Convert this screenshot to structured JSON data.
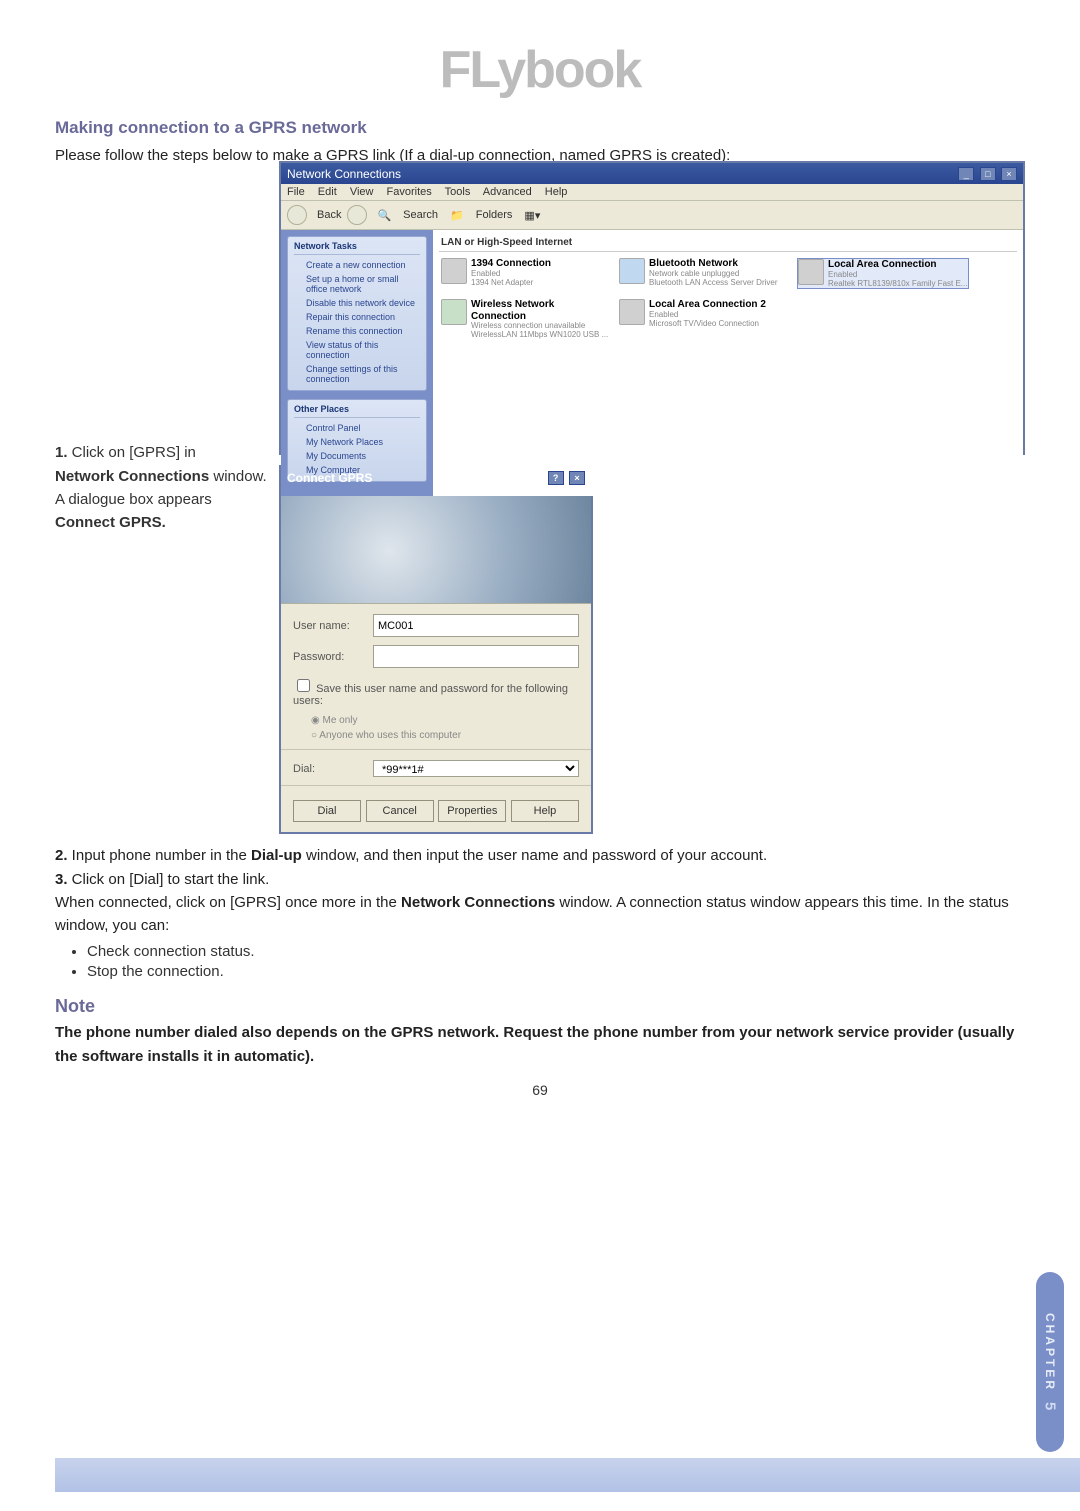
{
  "logo_text": "FLybook",
  "heading": "Making connection to a GPRS network",
  "intro": "Please follow the steps below to make a GPRS link (If a dial-up connection, named GPRS is created):",
  "step1_lead": "1.",
  "step1_text_a": " Click on [GPRS] in ",
  "step1_bold": "Network Connections",
  "step1_text_b": " window.",
  "step1_text_c": "A dialogue box appears ",
  "step1_bold2": "Connect GPRS.",
  "nc": {
    "title": "Network Connections",
    "menu": [
      "File",
      "Edit",
      "View",
      "Favorites",
      "Tools",
      "Advanced",
      "Help"
    ],
    "toolbar": {
      "back": "Back",
      "search": "Search",
      "folders": "Folders"
    },
    "panel1_title": "Network Tasks",
    "panel1_items": [
      "Create a new connection",
      "Set up a home or small office network",
      "Disable this network device",
      "Repair this connection",
      "Rename this connection",
      "View status of this connection",
      "Change settings of this connection"
    ],
    "panel2_title": "Other Places",
    "panel2_items": [
      "Control Panel",
      "My Network Places",
      "My Documents",
      "My Computer"
    ],
    "group_title": "LAN or High-Speed Internet",
    "items": [
      {
        "t": "1394 Connection",
        "s1": "Enabled",
        "s2": "1394 Net Adapter"
      },
      {
        "t": "Bluetooth Network",
        "s1": "Network cable unplugged",
        "s2": "Bluetooth LAN Access Server Driver"
      },
      {
        "t": "Local Area Connection",
        "s1": "Enabled",
        "s2": "Realtek RTL8139/810x Family Fast E..."
      },
      {
        "t": "Wireless Network Connection",
        "s1": "Wireless connection unavailable",
        "s2": "WirelessLAN 11Mbps WN1020 USB ..."
      },
      {
        "t": "Local Area Connection 2",
        "s1": "Enabled",
        "s2": "Microsoft TV/Video Connection"
      }
    ]
  },
  "dlg": {
    "title": "Connect GPRS",
    "user_label": "User name:",
    "user_value": "MC001",
    "pass_label": "Password:",
    "chk_label": "Save this user name and password for the following users:",
    "radio1": "Me only",
    "radio2": "Anyone who uses this computer",
    "dial_label": "Dial:",
    "dial_value": "*99***1#",
    "btns": [
      "Dial",
      "Cancel",
      "Properties",
      "Help"
    ]
  },
  "step2_lead": "2.",
  "step2_a": " Input phone number in the ",
  "step2_bold": "Dial-up",
  "step2_b": " window, and then input the user name and password of your account.",
  "step3_lead": "3.",
  "step3_a": " Click on [Dial] to start the link.",
  "para4_a": "When connected, click on [GPRS] once more in the ",
  "para4_bold": "Network Connections",
  "para4_b": " window. A connection status window appears this time. In the status window, you can:",
  "bullets": [
    "Check connection status.",
    "Stop the connection."
  ],
  "note_head": "Note",
  "note_body": "The phone number dialed also depends on the GPRS network. Request the phone number from your network service provider (usually the software installs it in automatic).",
  "page_number": "69",
  "side_tab": "CHAPTER",
  "side_tab_num": "5"
}
